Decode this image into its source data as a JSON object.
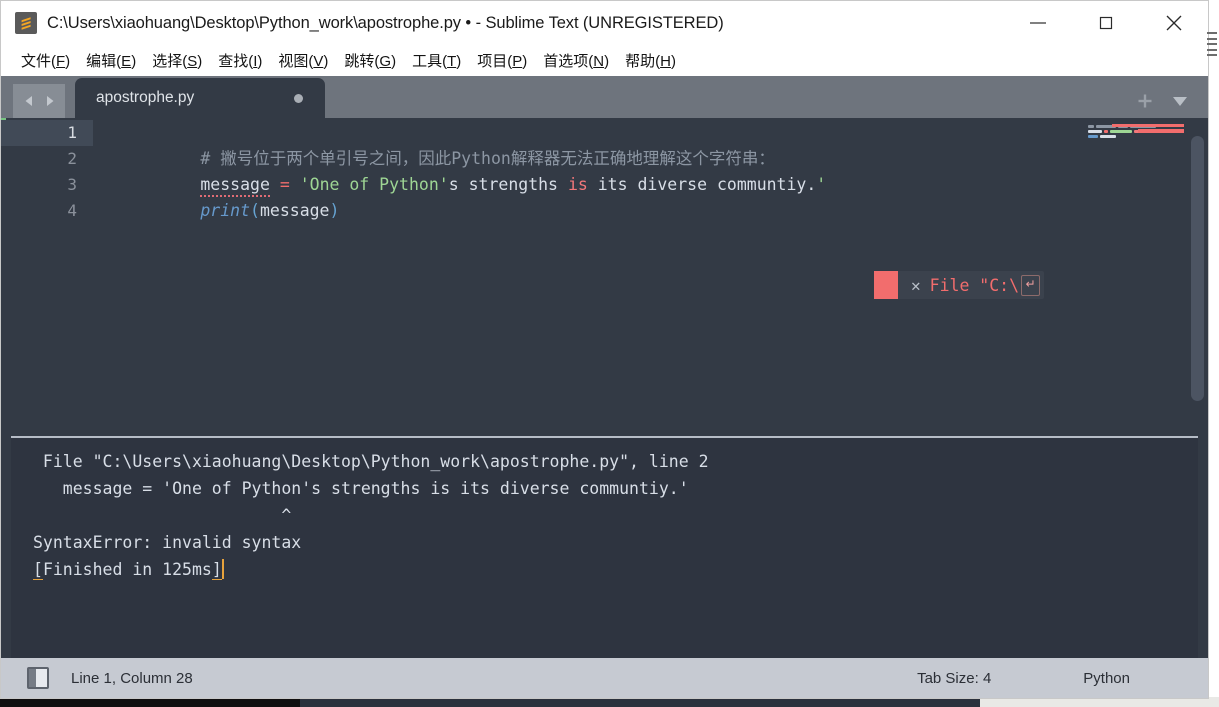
{
  "window": {
    "title": "C:\\Users\\xiaohuang\\Desktop\\Python_work\\apostrophe.py • - Sublime Text (UNREGISTERED)",
    "logo_icon": "sublime-text-logo-icon",
    "minimize_icon": "minimize-icon",
    "maximize_icon": "maximize-icon",
    "close_icon": "close-icon"
  },
  "menu": {
    "items": [
      {
        "label": "文件(F)",
        "text": "文件(",
        "accel": "F",
        "tail": ")"
      },
      {
        "label": "编辑(E)",
        "text": "编辑(",
        "accel": "E",
        "tail": ")"
      },
      {
        "label": "选择(S)",
        "text": "选择(",
        "accel": "S",
        "tail": ")"
      },
      {
        "label": "查找(I)",
        "text": "查找(",
        "accel": "I",
        "tail": ")"
      },
      {
        "label": "视图(V)",
        "text": "视图(",
        "accel": "V",
        "tail": ")"
      },
      {
        "label": "跳转(G)",
        "text": "跳转(",
        "accel": "G",
        "tail": ")"
      },
      {
        "label": "工具(T)",
        "text": "工具(",
        "accel": "T",
        "tail": ")"
      },
      {
        "label": "项目(P)",
        "text": "项目(",
        "accel": "P",
        "tail": ")"
      },
      {
        "label": "首选项(N)",
        "text": "首选项(",
        "accel": "N",
        "tail": ")"
      },
      {
        "label": "帮助(H)",
        "text": "帮助(",
        "accel": "H",
        "tail": ")"
      }
    ]
  },
  "tabs": {
    "prev_icon": "arrow-left-icon",
    "next_icon": "arrow-right-icon",
    "active": {
      "label": "apostrophe.py",
      "dirty": true
    },
    "new_tab_icon": "plus-icon",
    "tab_menu_icon": "chevron-down-icon"
  },
  "editor": {
    "gutter": [
      "1",
      "2",
      "3",
      "4"
    ],
    "current_line": 1,
    "lines": [
      {
        "number": "1",
        "tokens": [
          {
            "text": "# 撇号位于两个单引号之间，因此Python解释器无法正确地理解这个字符串：",
            "type": "comment"
          }
        ]
      },
      {
        "number": "2",
        "tokens": [
          {
            "text": "message",
            "type": "plain-squiggly"
          },
          {
            "text": " ",
            "type": "plain"
          },
          {
            "text": "=",
            "type": "op"
          },
          {
            "text": " ",
            "type": "plain"
          },
          {
            "text": "'One of Python'",
            "type": "string"
          },
          {
            "text": "s strengths ",
            "type": "plain"
          },
          {
            "text": "is",
            "type": "kw"
          },
          {
            "text": " its diverse communtiy.",
            "type": "plain"
          },
          {
            "text": "'",
            "type": "string"
          }
        ]
      },
      {
        "number": "3",
        "tokens": [
          {
            "text": "print",
            "type": "func"
          },
          {
            "text": "(",
            "type": "paren"
          },
          {
            "text": "message",
            "type": "plain"
          },
          {
            "text": ")",
            "type": "paren"
          }
        ]
      },
      {
        "number": "4",
        "tokens": []
      }
    ],
    "inline_error": {
      "close_icon": "close-small-icon",
      "text": "File \"C:\\",
      "enter_icon": "enter-key-icon",
      "swatch_color": "#f26d6d"
    },
    "minimap": {
      "present": true,
      "error_marker_color": "#f26d6d"
    },
    "scrollbar": {
      "present": true
    }
  },
  "console": {
    "lines": [
      " File \"C:\\Users\\xiaohuang\\Desktop\\Python_work\\apostrophe.py\", line 2",
      "   message = 'One of Python's strengths is its diverse communtiy.'",
      "                         ^",
      "SyntaxError: invalid syntax",
      "[Finished in 125ms]"
    ],
    "finished_prefix": "[",
    "finished_body": "Finished in 125ms",
    "finished_suffix": "]"
  },
  "status_bar": {
    "sidebar_toggle_icon": "sidebar-toggle-icon",
    "caret_position": "Line 1, Column 28",
    "tab_size": "Tab Size: 4",
    "syntax": "Python"
  },
  "colors": {
    "editor_bg": "#333a45",
    "console_bg": "#2e3440",
    "tabbar_bg": "#6e747d",
    "status_bg": "#c6cad2",
    "accent_error": "#f26d6d",
    "string_green": "#9ed694",
    "func_blue": "#6699cc"
  }
}
